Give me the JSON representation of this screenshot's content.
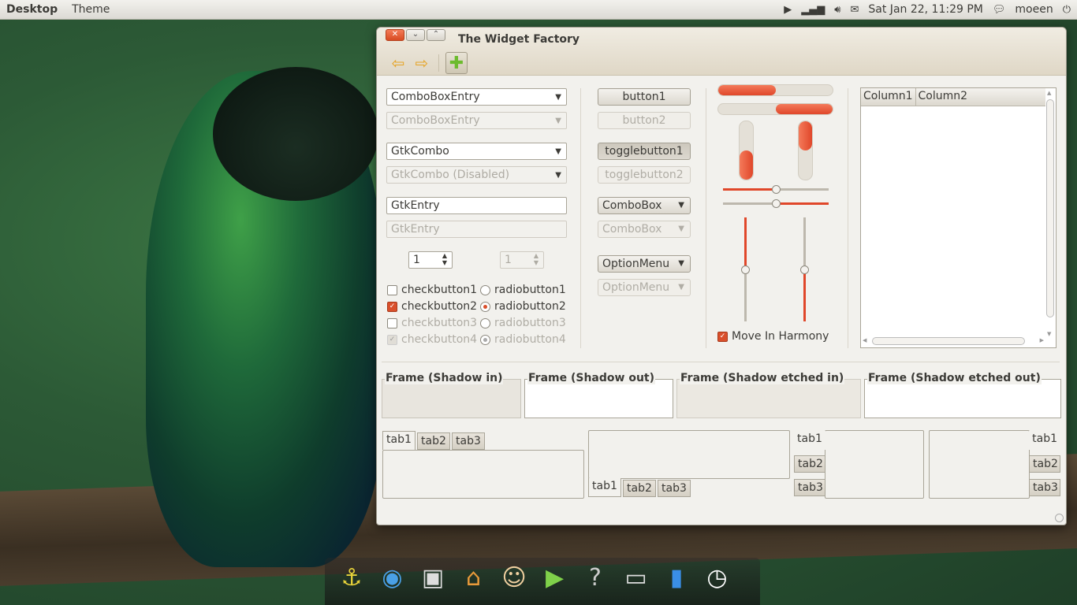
{
  "panel": {
    "app_name": "Desktop",
    "menus": [
      "Theme"
    ],
    "clock": "Sat Jan 22, 11:29 PM",
    "user": "moeen",
    "icons": [
      "media-player-indicator-icon",
      "network-signal-icon",
      "volume-icon",
      "mail-icon",
      "chat-icon",
      "power-icon"
    ]
  },
  "window": {
    "title": "The Widget Factory",
    "controls": [
      "close",
      "minimize",
      "maximize"
    ],
    "toolbar": [
      "back-arrow-icon",
      "forward-arrow-icon",
      "add-icon"
    ]
  },
  "col1": {
    "comboboxentry": "ComboBoxEntry",
    "comboboxentry_dis": "ComboBoxEntry",
    "gtkcombo": "GtkCombo",
    "gtkcombo_dis": "GtkCombo (Disabled)",
    "gtkentry": "GtkEntry",
    "gtkentry_dis": "GtkEntry",
    "spin": "1",
    "spin_dis": "1",
    "checks": [
      {
        "label": "checkbutton1",
        "checked": false,
        "disabled": false
      },
      {
        "label": "checkbutton2",
        "checked": true,
        "disabled": false
      },
      {
        "label": "checkbutton3",
        "checked": false,
        "disabled": true
      },
      {
        "label": "checkbutton4",
        "checked": true,
        "disabled": true
      }
    ],
    "radios": [
      {
        "label": "radiobutton1",
        "checked": false,
        "disabled": false
      },
      {
        "label": "radiobutton2",
        "checked": true,
        "disabled": false
      },
      {
        "label": "radiobutton3",
        "checked": false,
        "disabled": true
      },
      {
        "label": "radiobutton4",
        "checked": true,
        "disabled": true
      }
    ]
  },
  "col2": {
    "button1": "button1",
    "button2": "button2",
    "toggle1": "togglebutton1",
    "toggle2": "togglebutton2",
    "combobox": "ComboBox",
    "combobox_dis": "ComboBox",
    "optionmenu": "OptionMenu",
    "optionmenu_dis": "OptionMenu"
  },
  "col3": {
    "progress_h1": 0.5,
    "progress_h2": 0.5,
    "progress_v1": 0.5,
    "progress_v2": 0.5,
    "slider_h1": 0.5,
    "slider_h2": 0.5,
    "slider_v1": 0.5,
    "slider_v2": 0.5,
    "harmony_label": "Move In Harmony",
    "harmony_checked": true
  },
  "tree": {
    "columns": [
      "Column1",
      "Column2"
    ]
  },
  "frames": [
    "Frame (Shadow in)",
    "Frame (Shadow out)",
    "Frame (Shadow etched in)",
    "Frame (Shadow etched out)"
  ],
  "notebooks": {
    "tabs": [
      "tab1",
      "tab2",
      "tab3"
    ]
  },
  "dock": [
    "anchor-icon",
    "browser-icon",
    "terminal-icon",
    "home-folder-icon",
    "people-icon",
    "media-player-icon",
    "help-icon",
    "drive-icon",
    "battery-icon",
    "clock-icon"
  ]
}
